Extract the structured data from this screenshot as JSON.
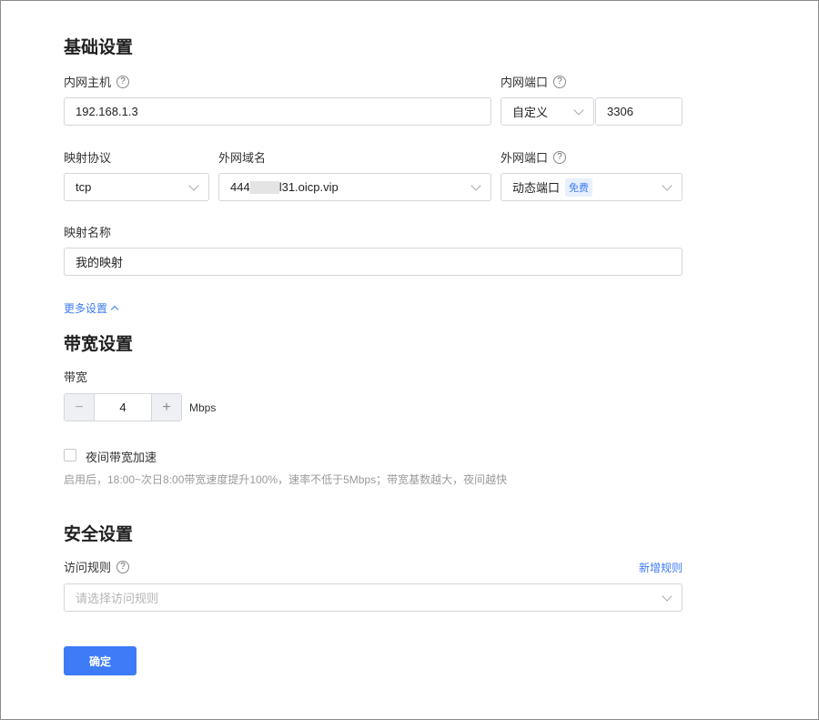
{
  "basic": {
    "title": "基础设置",
    "host_label": "内网主机",
    "host_value": "192.168.1.3",
    "port_label": "内网端口",
    "port_mode": "自定义",
    "port_value": "3306",
    "protocol_label": "映射协议",
    "protocol_value": "tcp",
    "domain_label": "外网域名",
    "domain_prefix": "444",
    "domain_suffix": "l31.oicp.vip",
    "ext_port_label": "外网端口",
    "ext_port_value": "动态端口",
    "ext_port_tag": "免费",
    "name_label": "映射名称",
    "name_value": "我的映射",
    "more": "更多设置"
  },
  "bandwidth": {
    "title": "带宽设置",
    "label": "带宽",
    "value": "4",
    "unit": "Mbps",
    "night_label": "夜间带宽加速",
    "night_checked": false,
    "hint": "启用后，18:00~次日8:00带宽速度提升100%，速率不低于5Mbps；带宽基数越大，夜间越快"
  },
  "security": {
    "title": "安全设置",
    "rule_label": "访问规则",
    "add_rule": "新增规则",
    "rule_placeholder": "请选择访问规则"
  },
  "submit": "确定",
  "colors": {
    "accent": "#3d7bf7"
  }
}
